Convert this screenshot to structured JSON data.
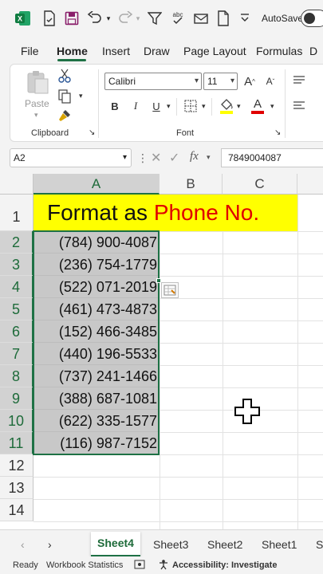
{
  "quick_access": {
    "autosave_label": "AutoSave"
  },
  "tabs": [
    {
      "label": "File"
    },
    {
      "label": "Home"
    },
    {
      "label": "Insert"
    },
    {
      "label": "Draw"
    },
    {
      "label": "Page Layout"
    },
    {
      "label": "Formulas"
    },
    {
      "label": "D"
    }
  ],
  "ribbon": {
    "clipboard": {
      "paste_label": "Paste",
      "group_label": "Clipboard"
    },
    "font": {
      "font_name": "Calibri",
      "font_size": "11",
      "bold": "B",
      "italic": "I",
      "underline": "U",
      "grow": "A",
      "shrink": "A",
      "font_color": "A",
      "group_label": "Font"
    }
  },
  "formula_bar": {
    "name_box": "A2",
    "fx": "fx",
    "value": "7849004087"
  },
  "grid": {
    "columns": [
      "A",
      "B",
      "C"
    ],
    "rows": [
      "1",
      "2",
      "3",
      "4",
      "5",
      "6",
      "7",
      "8",
      "9",
      "10",
      "11",
      "12",
      "13",
      "14"
    ],
    "title_part1": "Format as ",
    "title_part2": "Phone No.",
    "phones": [
      "(784) 900-4087",
      "(236) 754-1779",
      "(522) 071-2019",
      "(461) 473-4873",
      "(152) 466-3485",
      "(440) 196-5533",
      "(737) 241-1466",
      "(388) 687-1081",
      "(622) 335-1577",
      "(116) 987-7152"
    ]
  },
  "sheets": [
    "Sheet4",
    "Sheet3",
    "Sheet2",
    "Sheet1",
    "S"
  ],
  "status": {
    "ready": "Ready",
    "workbook_stats": "Workbook Statistics",
    "accessibility": "Accessibility: Investigate"
  },
  "colors": {
    "accent": "#1e7145",
    "title_fill": "#ffff00",
    "title_red": "#e00000",
    "selection_fill": "#c8c8c8"
  }
}
